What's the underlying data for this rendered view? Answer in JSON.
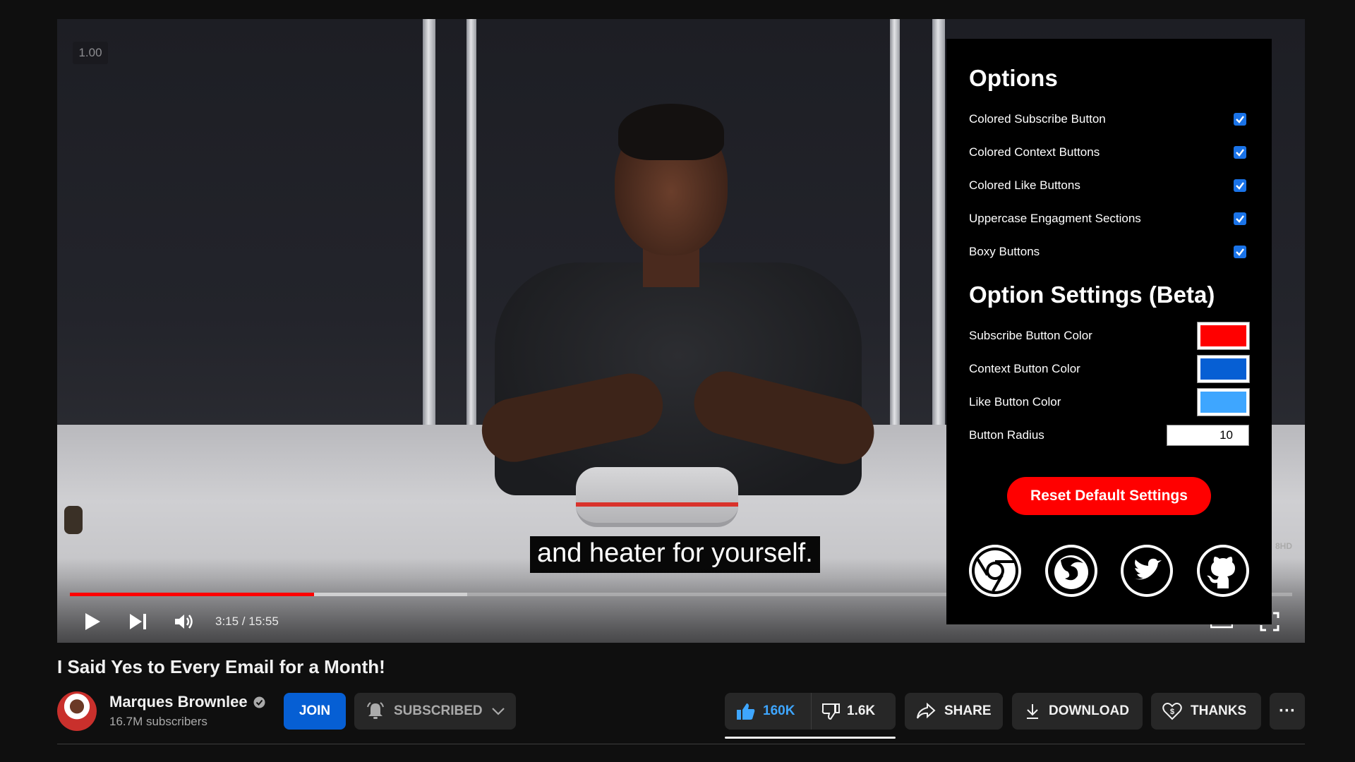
{
  "player": {
    "speed_badge": "1.00",
    "caption": "and heater for yourself.",
    "time": "3:15 / 15:55",
    "progress_played": 0.2,
    "progress_buffered": 0.325,
    "hd_label": "8HD"
  },
  "options": {
    "heading": "Options",
    "toggles": [
      {
        "label": "Colored Subscribe Button",
        "checked": true
      },
      {
        "label": "Colored Context Buttons",
        "checked": true
      },
      {
        "label": "Colored Like Buttons",
        "checked": true
      },
      {
        "label": "Uppercase Engagment Sections",
        "checked": true
      },
      {
        "label": "Boxy Buttons",
        "checked": true
      }
    ],
    "settings_heading": "Option Settings (Beta)",
    "colors": [
      {
        "label": "Subscribe Button Color",
        "value": "#ff0000"
      },
      {
        "label": "Context Button Color",
        "value": "#065fd4"
      },
      {
        "label": "Like Button Color",
        "value": "#3ea6ff"
      }
    ],
    "radius_label": "Button Radius",
    "radius_value": "10",
    "reset_label": "Reset Default Settings",
    "social": [
      "chrome-icon",
      "firefox-icon",
      "twitter-icon",
      "github-icon"
    ]
  },
  "video": {
    "title": "I Said Yes to Every Email for a Month!",
    "channel_name": "Marques Brownlee",
    "subscribers": "16.7M subscribers",
    "join_label": "JOIN",
    "subscribed_label": "SUBSCRIBED",
    "likes": "160K",
    "dislikes": "1.6K",
    "share_label": "SHARE",
    "download_label": "DOWNLOAD",
    "thanks_label": "THANKS",
    "more_label": "···"
  }
}
